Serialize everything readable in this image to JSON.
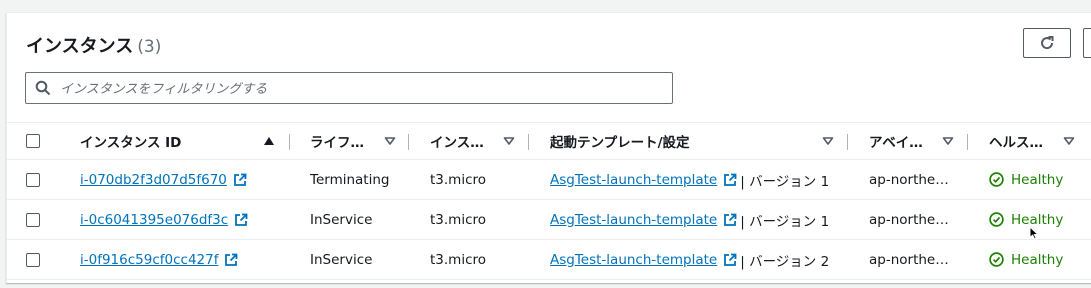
{
  "header": {
    "title": "インスタンス",
    "count": "(3)"
  },
  "search": {
    "placeholder": "インスタンスをフィルタリングする",
    "value": ""
  },
  "columns": {
    "instance_id": "インスタンス ID",
    "lifecycle": "ライフ…",
    "instance_type": "インス…",
    "launch_template": "起動テンプレート/設定",
    "availability_zone": "アベイ…",
    "health": "ヘルス…"
  },
  "rows": [
    {
      "id": "i-070db2f3d07d5f670",
      "lifecycle": "Terminating",
      "type": "t3.micro",
      "template": "AsgTest-launch-template",
      "version": "| バージョン 1",
      "az": "ap-northe…",
      "health": "Healthy"
    },
    {
      "id": "i-0c6041395e076df3c",
      "lifecycle": "InService",
      "type": "t3.micro",
      "template": "AsgTest-launch-template",
      "version": "| バージョン 1",
      "az": "ap-northe…",
      "health": "Healthy"
    },
    {
      "id": "i-0f916c59cf0cc427f",
      "lifecycle": "InService",
      "type": "t3.micro",
      "template": "AsgTest-launch-template",
      "version": "| バージョン 2",
      "az": "ap-northe…",
      "health": "Healthy"
    }
  ],
  "icons": {
    "refresh": "refresh-icon",
    "search": "search-icon",
    "external_link": "external-link-icon",
    "status_ok": "status-positive-icon",
    "sort": "sort-ascending-icon",
    "filter_caret": "caret-down-icon"
  },
  "colors": {
    "link": "#0073bb",
    "healthy": "#1d8102",
    "text": "#16191f",
    "muted": "#687078"
  }
}
